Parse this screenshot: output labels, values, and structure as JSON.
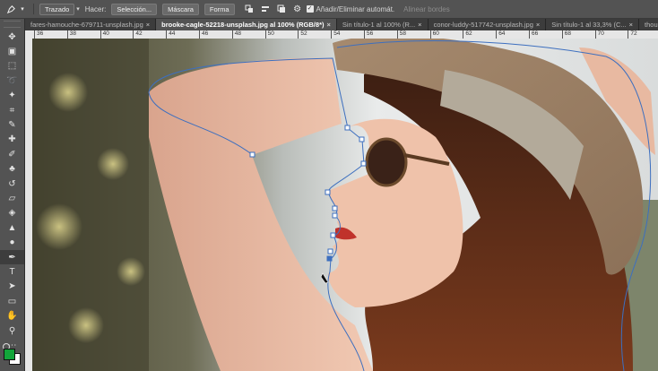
{
  "options_bar": {
    "mode_label": "Trazado",
    "make_label": "Hacer:",
    "selection_button": "Selección...",
    "mask_button": "Máscara",
    "shape_button": "Forma",
    "auto_add_delete_label": "Añadir/Eliminar automát.",
    "align_edges_label": "Alinear bordes"
  },
  "tabs": [
    {
      "label": "fares-hamouche-679711-unsplash.jpg"
    },
    {
      "label": "brooke-cagle-52218-unsplash.jpg al 100% (RGB/8*)",
      "active": true
    },
    {
      "label": "Sin título-1 al 100% (R..."
    },
    {
      "label": "conor-luddy-517742-unsplash.jpg"
    },
    {
      "label": "Sin título-1 al 33,3% (C..."
    },
    {
      "label": "though"
    }
  ],
  "ruler": {
    "labels": [
      "36",
      "38",
      "40",
      "42",
      "44",
      "46",
      "48",
      "50",
      "52",
      "54",
      "56",
      "58",
      "60",
      "62",
      "64",
      "66",
      "68",
      "70",
      "72"
    ]
  },
  "colors": {
    "foreground": "#12a53a",
    "background": "#ffffff",
    "path_stroke": "#3d6fbf"
  },
  "tools": [
    "move-tool-icon",
    "artboard-icon",
    "marquee-tool-icon",
    "lasso-tool-icon",
    "magic-wand-icon",
    "crop-tool-icon",
    "eyedropper-icon",
    "healing-brush-icon",
    "brush-tool-icon",
    "clone-stamp-icon",
    "history-brush-icon",
    "eraser-icon",
    "paint-bucket-icon",
    "blur-tool-icon",
    "dodge-tool-icon",
    "pen-tool-icon",
    "type-tool-icon",
    "path-selection-icon",
    "shape-tool-icon",
    "hand-tool-icon",
    "zoom-tool-icon",
    "more-tools-icon"
  ]
}
